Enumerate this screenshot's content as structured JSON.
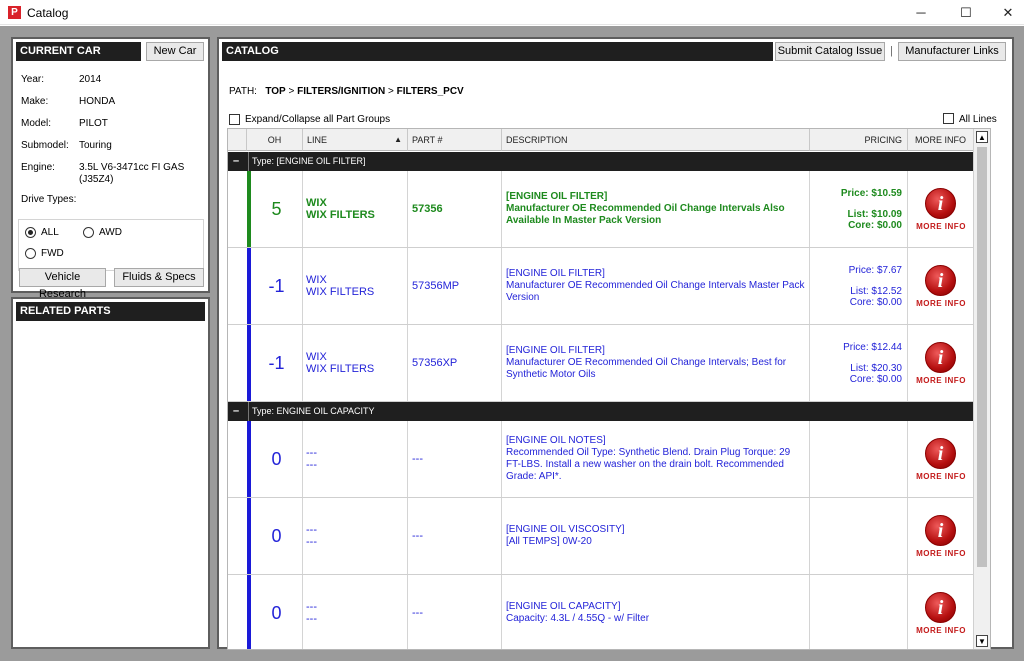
{
  "window": {
    "title": "Catalog",
    "icon_letter": "P",
    "min": "─",
    "max": "☐",
    "close": "✕"
  },
  "current_car": {
    "header": "CURRENT CAR",
    "new_car_label": "New Car",
    "fields": [
      {
        "label": "Year:",
        "value": "2014"
      },
      {
        "label": "Make:",
        "value": "HONDA"
      },
      {
        "label": "Model:",
        "value": "PILOT"
      },
      {
        "label": "Submodel:",
        "value": "Touring"
      },
      {
        "label": "Engine:",
        "value": "3.5L  V6-3471cc  FI  GAS (J35Z4)"
      }
    ],
    "drive_types_label": "Drive Types:",
    "drive_options": [
      {
        "label": "ALL",
        "checked": true
      },
      {
        "label": "AWD",
        "checked": false
      },
      {
        "label": "FWD",
        "checked": false
      }
    ],
    "vehicle_research_label": "Vehicle Research",
    "fluids_specs_label": "Fluids & Specs"
  },
  "related_parts": {
    "header": "RELATED PARTS"
  },
  "catalog": {
    "header": "CATALOG",
    "submit_issue_label": "Submit Catalog Issue",
    "separator": "|",
    "manufacturer_links_label": "Manufacturer Links",
    "path_label": "PATH:",
    "path": [
      "TOP",
      "FILTERS/IGNITION",
      "FILTERS_PCV"
    ],
    "path_sep": ">",
    "expand_label": "Expand/Collapse all Part Groups",
    "all_lines_label": "All Lines",
    "columns": {
      "oh": "OH",
      "line": "LINE",
      "part": "PART #",
      "description": "DESCRIPTION",
      "pricing": "PRICING",
      "more_info": "MORE INFO"
    },
    "sort_indicator": "▲",
    "more_info_label": "MORE INFO",
    "info_glyph": "i",
    "groups": [
      {
        "toggle": "–",
        "label": "Type: [ENGINE OIL FILTER]",
        "rows": [
          {
            "oh": "5",
            "line1": "WIX",
            "line2": "WIX FILTERS",
            "part": "57356",
            "desc_title": "[ENGINE OIL FILTER]",
            "desc_body": "Manufacturer OE Recommended Oil Change Intervals Also Available In Master Pack Version",
            "price": "Price: $10.59",
            "list": "List: $10.09",
            "core": "Core: $0.00",
            "style": "green"
          },
          {
            "oh": "-1",
            "line1": "WIX",
            "line2": "WIX FILTERS",
            "part": "57356MP",
            "desc_title": "[ENGINE OIL FILTER]",
            "desc_body": "Manufacturer OE Recommended Oil Change Intervals Master Pack Version",
            "price": "Price: $7.67",
            "list": "List: $12.52",
            "core": "Core: $0.00",
            "style": "blue"
          },
          {
            "oh": "-1",
            "line1": "WIX",
            "line2": "WIX FILTERS",
            "part": "57356XP",
            "desc_title": "[ENGINE OIL FILTER]",
            "desc_body": "Manufacturer OE Recommended Oil Change Intervals; Best for Synthetic Motor Oils",
            "price": "Price: $12.44",
            "list": "List: $20.30",
            "core": "Core: $0.00",
            "style": "blue"
          }
        ]
      },
      {
        "toggle": "–",
        "label": "Type: ENGINE OIL CAPACITY",
        "rows": [
          {
            "oh": "0",
            "line1": "---",
            "line2": "---",
            "part": "---",
            "desc_title": "[ENGINE OIL NOTES]",
            "desc_body": "Recommended Oil Type: Synthetic Blend.  Drain Plug Torque: 29 FT-LBS.  Install a new washer on the drain bolt. Recommended Grade: API*.",
            "price": "",
            "list": "",
            "core": "",
            "style": "blue"
          },
          {
            "oh": "0",
            "line1": "---",
            "line2": "---",
            "part": "---",
            "desc_title": "[ENGINE OIL VISCOSITY]",
            "desc_body": "[All TEMPS] 0W-20",
            "price": "",
            "list": "",
            "core": "",
            "style": "blue"
          },
          {
            "oh": "0",
            "line1": "---",
            "line2": "---",
            "part": "---",
            "desc_title": "[ENGINE OIL CAPACITY]",
            "desc_body": "Capacity: 4.3L / 4.55Q  - w/ Filter",
            "price": "",
            "list": "",
            "core": "",
            "style": "blue"
          }
        ]
      }
    ]
  },
  "colors": {
    "green_bar": "#1e8a1e",
    "blue_bar": "#1a1ad8",
    "header_bg": "#1f1f1f",
    "workspace": "#9b9b9b"
  }
}
